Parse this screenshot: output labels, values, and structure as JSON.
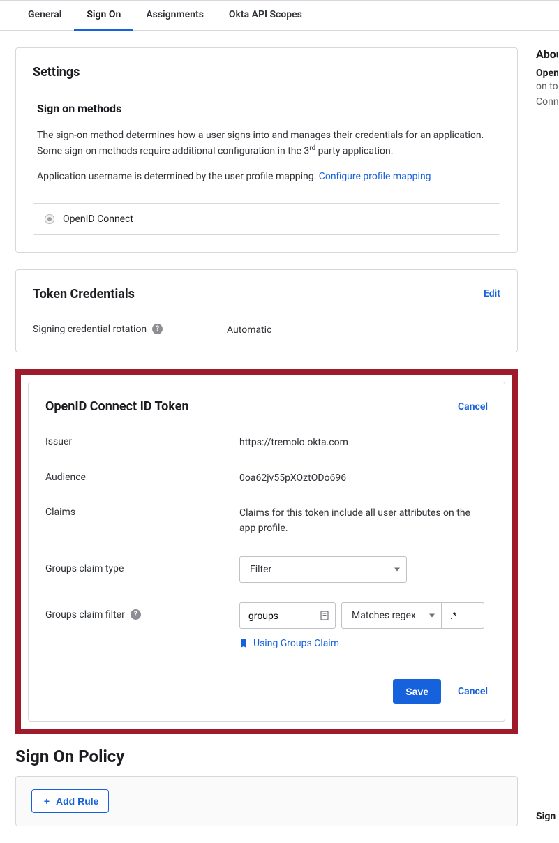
{
  "tabs": {
    "general": "General",
    "signon": "Sign On",
    "assignments": "Assignments",
    "scopes": "Okta API Scopes"
  },
  "settings": {
    "title": "Settings",
    "subheading": "Sign on methods",
    "desc_prefix": "The sign-on method determines how a user signs into and manages their credentials for an application. Some sign-on methods require additional configuration in the 3",
    "desc_sup": "rd",
    "desc_suffix": " party application.",
    "username_desc": "Application username is determined by the user profile mapping. ",
    "profile_link": "Configure profile mapping",
    "radio_label": "OpenID Connect"
  },
  "token_credentials": {
    "title": "Token Credentials",
    "edit": "Edit",
    "rotation_label": "Signing credential rotation",
    "rotation_value": "Automatic"
  },
  "id_token": {
    "title": "OpenID Connect ID Token",
    "cancel": "Cancel",
    "issuer_label": "Issuer",
    "issuer_value": "https://tremolo.okta.com",
    "audience_label": "Audience",
    "audience_value": "0oa62jv55pXOztODo696",
    "claims_label": "Claims",
    "claims_value": "Claims for this token include all user attributes on the app profile.",
    "groups_type_label": "Groups claim type",
    "groups_type_value": "Filter",
    "groups_filter_label": "Groups claim filter",
    "groups_filter_name": "groups",
    "groups_filter_op": "Matches regex",
    "groups_filter_pattern": ".*",
    "doc_link": "Using Groups Claim",
    "save": "Save",
    "cancel2": "Cancel"
  },
  "policy": {
    "heading": "Sign On Policy",
    "add_rule": "Add Rule"
  },
  "sidebar": {
    "about": "Abou",
    "open": "Open",
    "line2": "on to",
    "line3": "Conn",
    "sign": "Sign"
  }
}
